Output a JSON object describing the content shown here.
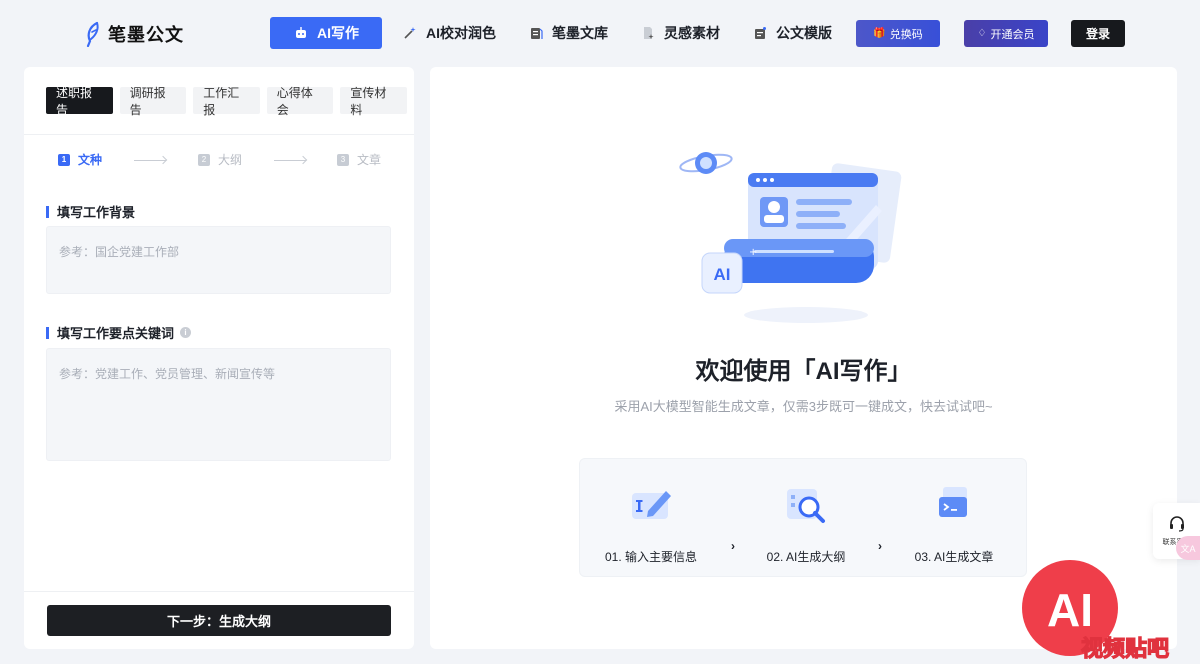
{
  "header": {
    "logo_text": "笔墨公文",
    "nav": [
      {
        "label": "AI写作",
        "icon": "robot-icon",
        "active": true
      },
      {
        "label": "AI校对润色",
        "icon": "magic-wand-icon",
        "active": false
      },
      {
        "label": "笔墨文库",
        "icon": "library-icon",
        "active": false
      },
      {
        "label": "灵感素材",
        "icon": "sparkle-doc-icon",
        "active": false
      },
      {
        "label": "公文模版",
        "icon": "template-icon",
        "active": false
      }
    ],
    "redeem_label": "兑换码",
    "vip_label": "开通会员",
    "login_label": "登录"
  },
  "left_panel": {
    "tabs": [
      "述职报告",
      "调研报告",
      "工作汇报",
      "心得体会",
      "宣传材料"
    ],
    "active_tab": 0,
    "steps": [
      {
        "num": "1",
        "label": "文种"
      },
      {
        "num": "2",
        "label": "大纲"
      },
      {
        "num": "3",
        "label": "文章"
      }
    ],
    "background_title": "填写工作背景",
    "background_placeholder": "参考：国企党建工作部",
    "keywords_title": "填写工作要点关键词",
    "keywords_placeholder": "参考：党建工作、党员管理、新闻宣传等",
    "next_button": "下一步：生成大纲"
  },
  "right_panel": {
    "illustration_badge": "AI",
    "welcome_title": "欢迎使用「AI写作」",
    "subtitle": "采用AI大模型智能生成文章，仅需3步既可一键成文，快去试试吧~",
    "steps": [
      {
        "label": "01. 输入主要信息",
        "icon": "edit-input-icon"
      },
      {
        "label": "02. AI生成大纲",
        "icon": "search-outline-icon"
      },
      {
        "label": "03. AI生成文章",
        "icon": "generate-doc-icon"
      }
    ]
  },
  "floating": {
    "contact_label": "联系客服",
    "translate_glyph": "文A"
  },
  "watermark": {
    "badge": "AI",
    "text": "视频贴吧"
  },
  "colors": {
    "accent": "#3a6af5",
    "dark": "#17191d",
    "background": "#f2f4f8"
  }
}
